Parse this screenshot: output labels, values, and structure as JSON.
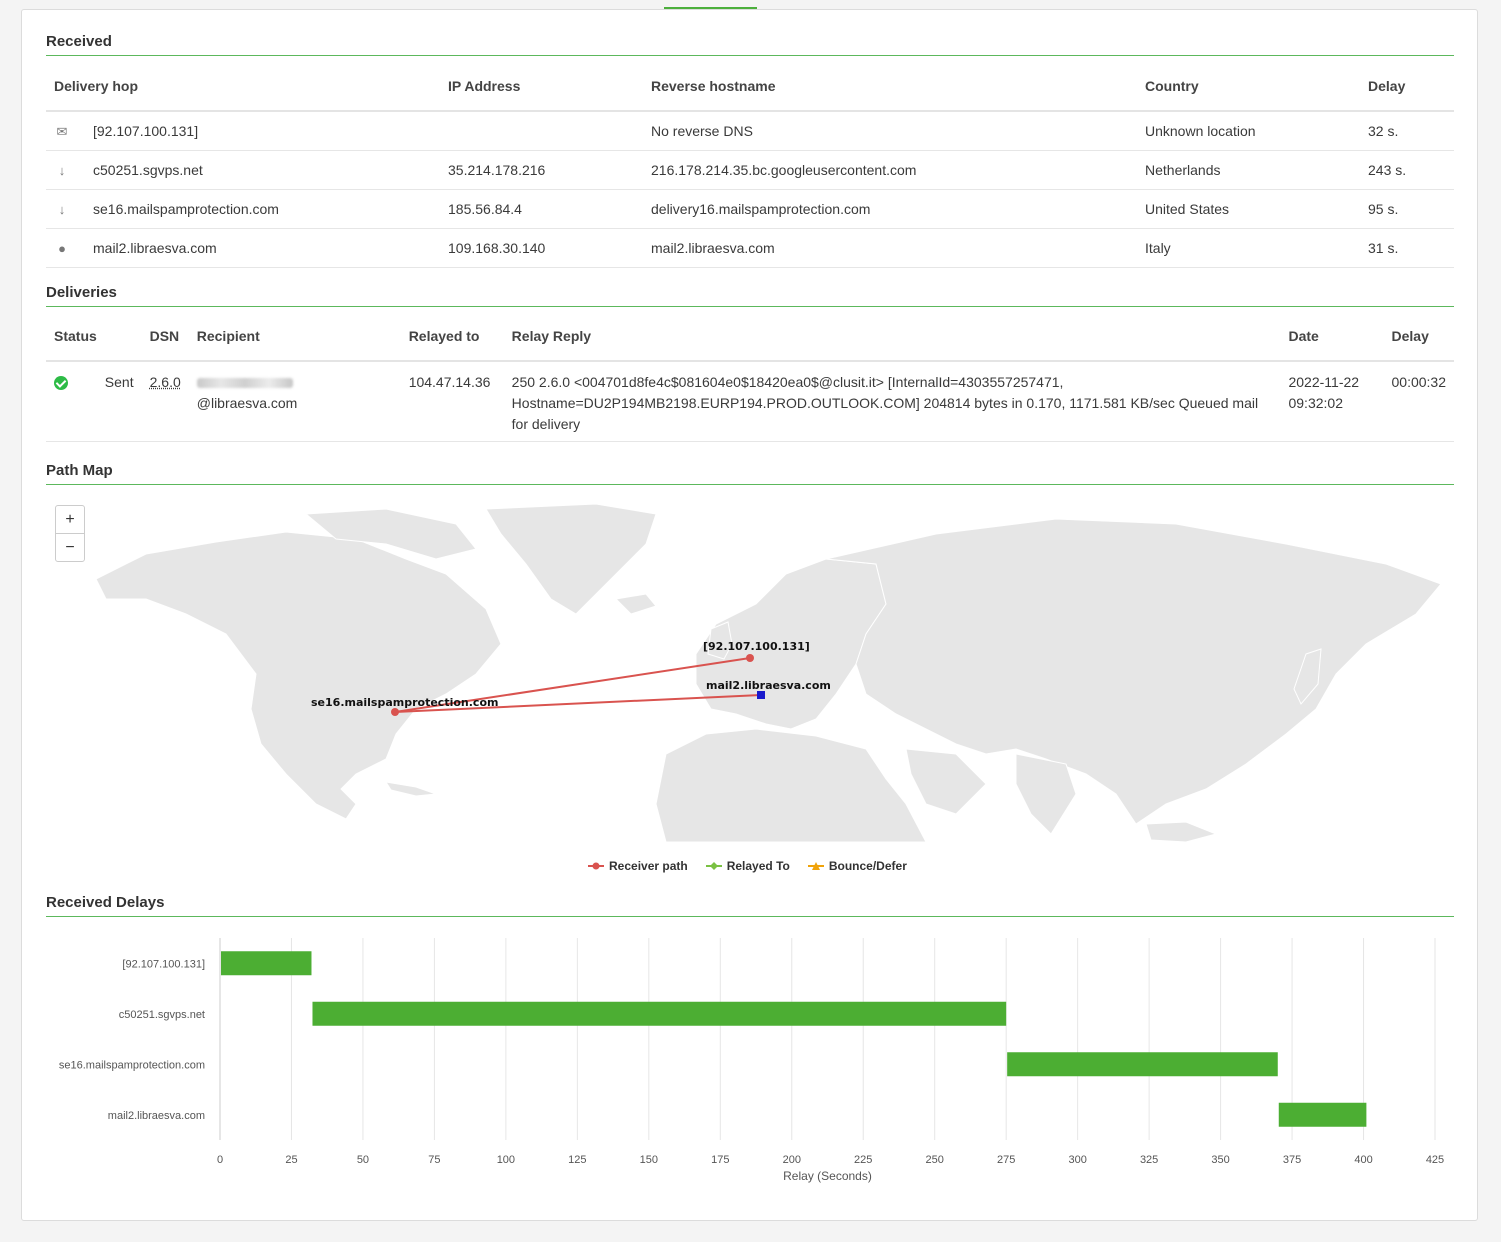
{
  "received": {
    "title": "Received",
    "columns": [
      "Delivery hop",
      "IP Address",
      "Reverse hostname",
      "Country",
      "Delay"
    ],
    "rows": [
      {
        "icon": "envelope-icon",
        "hop": "[92.107.100.131]",
        "ip": "",
        "reverse": "No reverse DNS",
        "country": "Unknown location",
        "delay": "32 s."
      },
      {
        "icon": "arrow-down-icon",
        "hop": "c50251.sgvps.net",
        "ip": "35.214.178.216",
        "reverse": "216.178.214.35.bc.googleusercontent.com",
        "country": "Netherlands",
        "delay": "243 s."
      },
      {
        "icon": "arrow-down-icon",
        "hop": "se16.mailspamprotection.com",
        "ip": "185.56.84.4",
        "reverse": "delivery16.mailspamprotection.com",
        "country": "United States",
        "delay": "95 s."
      },
      {
        "icon": "map-pin-icon",
        "hop": "mail2.libraesva.com",
        "ip": "109.168.30.140",
        "reverse": "mail2.libraesva.com",
        "country": "Italy",
        "delay": "31 s."
      }
    ]
  },
  "deliveries": {
    "title": "Deliveries",
    "columns": [
      "Status",
      "DSN",
      "Recipient",
      "Relayed to",
      "Relay Reply",
      "Date",
      "Delay"
    ],
    "rows": [
      {
        "status_icon": "check-circle-icon",
        "status": "Sent",
        "dsn": "2.6.0",
        "recipient_suffix": "@libraesva.com",
        "relayed_to": "104.47.14.36",
        "relay_reply": "250 2.6.0 <004701d8fe4c$081604e0$18420ea0$@clusit.it> [InternalId=4303557257471, Hostname=DU2P194MB2198.EURP194.PROD.OUTLOOK.COM] 204814 bytes in 0.170, 1171.581 KB/sec Queued mail for delivery",
        "date_line1": "2022-11-22",
        "date_line2": "09:32:02",
        "delay": "00:00:32"
      }
    ]
  },
  "path_map": {
    "title": "Path Map",
    "zoom_in": "+",
    "zoom_out": "−",
    "markers": [
      {
        "label": "[92.107.100.131]"
      },
      {
        "label": "mail2.libraesva.com"
      },
      {
        "label": "se16.mailspamprotection.com"
      }
    ],
    "legend": [
      {
        "label": "Receiver path",
        "color": "#d9534f"
      },
      {
        "label": "Relayed To",
        "color": "#7ac143"
      },
      {
        "label": "Bounce/Defer",
        "color": "#f0a30a"
      }
    ]
  },
  "received_delays": {
    "title": "Received Delays"
  },
  "chart_data": {
    "type": "bar",
    "orientation": "horizontal-floating",
    "categories": [
      "[92.107.100.131]",
      "c50251.sgvps.net",
      "se16.mailspamprotection.com",
      "mail2.libraesva.com"
    ],
    "ranges": [
      [
        0,
        32
      ],
      [
        32,
        275
      ],
      [
        275,
        370
      ],
      [
        370,
        401
      ]
    ],
    "color": "#4cae33",
    "xlabel": "Relay (Seconds)",
    "xlim": [
      0,
      425
    ],
    "xticks": [
      0,
      25,
      50,
      75,
      100,
      125,
      150,
      175,
      200,
      225,
      250,
      275,
      300,
      325,
      350,
      375,
      400,
      425
    ],
    "grid": true
  }
}
